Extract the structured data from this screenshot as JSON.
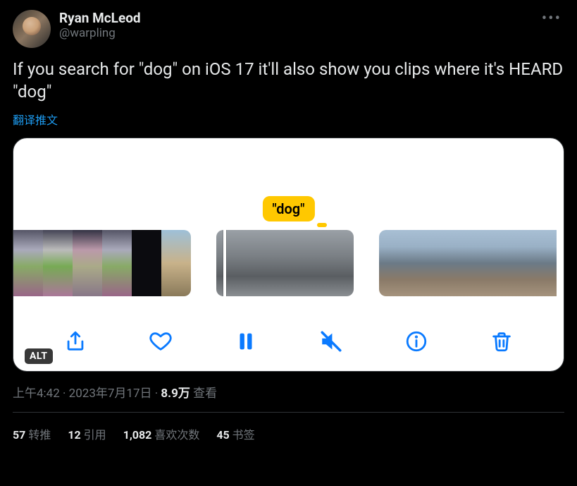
{
  "author": {
    "display_name": "Ryan McLeod",
    "handle": "@warpling"
  },
  "tweet_text": "If you search for \"dog\" on iOS 17 it'll also show you clips where it's HEARD \"dog\"",
  "translate_label": "翻译推文",
  "media": {
    "caption_bubble": "\"dog\"",
    "alt_badge": "ALT"
  },
  "meta": {
    "time": "上午4:42",
    "dot1": " · ",
    "date": "2023年7月17日",
    "dot2": " · ",
    "views_value": "8.9万",
    "views_label": " 查看"
  },
  "stats": {
    "retweets_value": "57",
    "retweets_label": " 转推",
    "quotes_value": "12",
    "quotes_label": " 引用",
    "likes_value": "1,082",
    "likes_label": " 喜欢次数",
    "bookmarks_value": "45",
    "bookmarks_label": " 书签"
  }
}
